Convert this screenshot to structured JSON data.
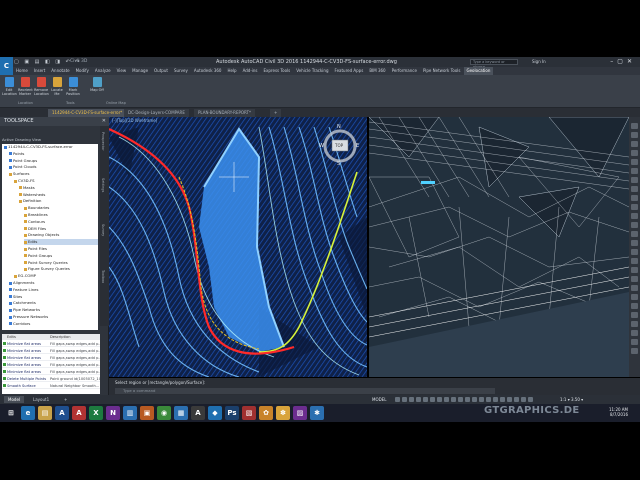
{
  "window": {
    "app_title": "Autodesk AutoCAD Civil 3D 2016    1142944-C-CV3D-FS-surface-error.dwg",
    "quick_access": "▢ ▣ ▤ ◧ ◨ ↶ ↷",
    "tab_name": "Civil 3D",
    "search_placeholder": "Type a keyword or phrase",
    "sign_in": "Sign In",
    "logo": "C"
  },
  "ribbon": {
    "tabs": [
      "Home",
      "Insert",
      "Annotate",
      "Modify",
      "Analyze",
      "View",
      "Manage",
      "Output",
      "Survey",
      "Autodesk 360",
      "Help",
      "Add-ins",
      "Express Tools",
      "Vehicle Tracking",
      "Featured Apps",
      "BIM 360",
      "Performance",
      "Pipe Network Tools",
      "Geolocation"
    ],
    "active_tab": "Geolocation",
    "buttons": [
      {
        "label": "Edit Location",
        "color": "#3b8ed8"
      },
      {
        "label": "Reorient Marker",
        "color": "#d84a3b"
      },
      {
        "label": "Remove Location",
        "color": "#d84a3b"
      },
      {
        "label": "Locate Me",
        "color": "#d8a43b"
      },
      {
        "label": "Mark Position",
        "color": "#3b8ed8"
      },
      {
        "label": "Map Off",
        "color": "#4fa0c8"
      }
    ],
    "panels": [
      "Location",
      "Tools",
      "Online Map"
    ]
  },
  "file_tabs": [
    {
      "label": "1142944-C-CV3D-FS-surface-error*",
      "active": true
    },
    {
      "label": "DC-Design-Layers-COMPARE",
      "active": false
    },
    {
      "label": "PLAN-BOUNDARY-REPORT*",
      "active": false
    },
    {
      "label": "+",
      "active": false
    }
  ],
  "toolspace": {
    "title": "TOOLSPACE",
    "view_label": "Active Drawing View",
    "tree": [
      {
        "label": "1142944-C-CV3D-FS-surface-error",
        "level": 0,
        "color": "#3a7bd5",
        "selected": false
      },
      {
        "label": "Points",
        "level": 1,
        "color": "#3a7bd5",
        "selected": false
      },
      {
        "label": "Point Groups",
        "level": 1,
        "color": "#3a7bd5",
        "selected": false
      },
      {
        "label": "Point Clouds",
        "level": 1,
        "color": "#3a7bd5",
        "selected": false
      },
      {
        "label": "Surfaces",
        "level": 1,
        "color": "#d9a43b",
        "selected": false
      },
      {
        "label": "CV3D-FS",
        "level": 2,
        "color": "#d9a43b",
        "selected": false
      },
      {
        "label": "Masks",
        "level": 3,
        "color": "#d9a43b",
        "selected": false
      },
      {
        "label": "Watersheds",
        "level": 3,
        "color": "#d9a43b",
        "selected": false
      },
      {
        "label": "Definition",
        "level": 3,
        "color": "#d9a43b",
        "selected": false
      },
      {
        "label": "Boundaries",
        "level": 4,
        "color": "#d9a43b",
        "selected": false
      },
      {
        "label": "Breaklines",
        "level": 4,
        "color": "#d9a43b",
        "selected": false
      },
      {
        "label": "Contours",
        "level": 4,
        "color": "#d9a43b",
        "selected": false
      },
      {
        "label": "DEM Files",
        "level": 4,
        "color": "#d9a43b",
        "selected": false
      },
      {
        "label": "Drawing Objects",
        "level": 4,
        "color": "#d9a43b",
        "selected": false
      },
      {
        "label": "Edits",
        "level": 4,
        "color": "#d9a43b",
        "selected": true
      },
      {
        "label": "Point Files",
        "level": 4,
        "color": "#d9a43b",
        "selected": false
      },
      {
        "label": "Point Groups",
        "level": 4,
        "color": "#d9a43b",
        "selected": false
      },
      {
        "label": "Point Survey Queries",
        "level": 4,
        "color": "#d9a43b",
        "selected": false
      },
      {
        "label": "Figure Survey Queries",
        "level": 4,
        "color": "#d9a43b",
        "selected": false
      },
      {
        "label": "EG-COMP",
        "level": 2,
        "color": "#d9a43b",
        "selected": false
      },
      {
        "label": "Alignments",
        "level": 1,
        "color": "#3a7bd5",
        "selected": false
      },
      {
        "label": "Feature Lines",
        "level": 1,
        "color": "#3a7bd5",
        "selected": false
      },
      {
        "label": "Sites",
        "level": 1,
        "color": "#3a7bd5",
        "selected": false
      },
      {
        "label": "Catchments",
        "level": 1,
        "color": "#3a7bd5",
        "selected": false
      },
      {
        "label": "Pipe Networks",
        "level": 1,
        "color": "#3a7bd5",
        "selected": false
      },
      {
        "label": "Pressure Networks",
        "level": 1,
        "color": "#3a7bd5",
        "selected": false
      },
      {
        "label": "Corridors",
        "level": 1,
        "color": "#3a7bd5",
        "selected": false
      }
    ],
    "side_tabs": [
      "Prospector",
      "Settings",
      "Survey",
      "Toolbox"
    ]
  },
  "edits": {
    "columns": [
      "Edits",
      "Description"
    ],
    "rows": [
      {
        "edit": "Minimize flat areas",
        "desc": "Fill gaps,swap edges,add p..."
      },
      {
        "edit": "Minimize flat areas",
        "desc": "Fill gaps,swap edges,add p..."
      },
      {
        "edit": "Minimize flat areas",
        "desc": "Fill gaps,swap edges,add p..."
      },
      {
        "edit": "Minimize flat areas",
        "desc": "Fill gaps,swap edges,add p..."
      },
      {
        "edit": "Minimize flat areas",
        "desc": "Fill gaps,swap edges,add p..."
      },
      {
        "edit": "Delete Multiple Points",
        "desc": "Point ground id(1005072_101)..."
      },
      {
        "edit": "Smooth Surface",
        "desc": "Natural Neighbor Smooth..."
      }
    ]
  },
  "viewport": {
    "label": "[-][Top][2D Wireframe]",
    "compass": {
      "n": "N",
      "s": "S",
      "e": "E",
      "w": "W",
      "top": "TOP"
    }
  },
  "command": {
    "history": "Select region or [rectangle/polygon/Surface]:",
    "placeholder": "Type a command"
  },
  "status": {
    "layout_tabs": [
      "Model",
      "Layout1",
      "+"
    ],
    "active_layout": "Model",
    "model_label": "MODEL",
    "scale": "1:1 ▾  3.50 ▾"
  },
  "taskbar": {
    "apps": [
      {
        "label": "⊞",
        "color": "#1a1e2b"
      },
      {
        "label": "e",
        "color": "#1f6fb0"
      },
      {
        "label": "▤",
        "color": "#c8a24a"
      },
      {
        "label": "A",
        "color": "#1f4f8f"
      },
      {
        "label": "A",
        "color": "#b23333"
      },
      {
        "label": "X",
        "color": "#1d7a3f"
      },
      {
        "label": "N",
        "color": "#6b2d8f"
      },
      {
        "label": "▥",
        "color": "#2b6fb0"
      },
      {
        "label": "▣",
        "color": "#b85a22"
      },
      {
        "label": "◉",
        "color": "#3a8a3a"
      },
      {
        "label": "▦",
        "color": "#2b6fb0"
      },
      {
        "label": "A",
        "color": "#3a3a3a"
      },
      {
        "label": "◆",
        "color": "#1f6fb0"
      },
      {
        "label": "Ps",
        "color": "#1b3f6b"
      },
      {
        "label": "▧",
        "color": "#a03030"
      },
      {
        "label": "✿",
        "color": "#c8832a"
      },
      {
        "label": "✽",
        "color": "#d9a43b"
      },
      {
        "label": "▨",
        "color": "#6c2d8f"
      },
      {
        "label": "✱",
        "color": "#2b6fb0"
      }
    ],
    "time": "11:20 AM",
    "date": "8/7/2016"
  },
  "watermark": "GTGRAPHICS.DE"
}
